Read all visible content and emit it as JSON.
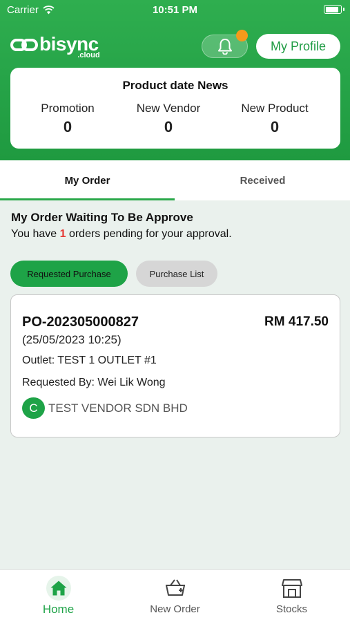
{
  "status_bar": {
    "carrier": "Carrier",
    "time": "10:51 PM",
    "battery_level": 0.9
  },
  "header": {
    "logo_text": "bisync",
    "logo_sub": ".cloud",
    "profile_button": "My Profile",
    "bell_has_notification": true
  },
  "news": {
    "title": "Product date News",
    "stats": [
      {
        "label": "Promotion",
        "value": "0"
      },
      {
        "label": "New Vendor",
        "value": "0"
      },
      {
        "label": "New Product",
        "value": "0"
      }
    ]
  },
  "tabs": [
    {
      "label": "My Order",
      "active": true
    },
    {
      "label": "Received",
      "active": false
    }
  ],
  "section": {
    "title": "My Order Waiting To Be Approve",
    "sub_prefix": "You have ",
    "pending_count": "1",
    "sub_suffix": " orders pending for your approval."
  },
  "filters": {
    "active": "Requested Purchase",
    "idle": "Purchase List"
  },
  "order": {
    "po_number": "PO-202305000827",
    "amount": "RM 417.50",
    "date": "(25/05/2023 10:25)",
    "outlet": "Outlet: TEST 1 OUTLET #1",
    "requested_by": "Requested By: Wei Lik Wong",
    "vendor_initial": "C",
    "vendor_name": "TEST VENDOR SDN BHD"
  },
  "bottom_nav": [
    {
      "label": "Home",
      "icon": "home-icon",
      "active": true
    },
    {
      "label": "New Order",
      "icon": "basket-add-icon",
      "active": false
    },
    {
      "label": "Stocks",
      "icon": "store-icon",
      "active": false
    }
  ],
  "colors": {
    "brand_green": "#27a549",
    "accent_orange": "#f59a1b",
    "alert_red": "#e53935"
  }
}
